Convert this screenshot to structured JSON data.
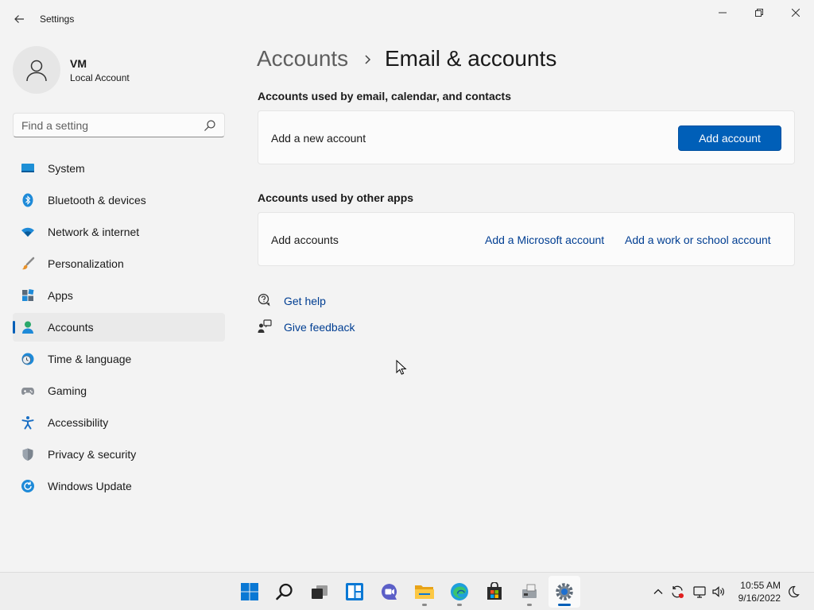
{
  "window": {
    "title": "Settings",
    "back_icon": "arrow-left-icon",
    "controls": [
      "minimize-icon",
      "restore-icon",
      "close-icon"
    ]
  },
  "user": {
    "name": "VM",
    "account_type": "Local Account",
    "avatar_icon": "person-icon"
  },
  "search": {
    "placeholder": "Find a setting",
    "value": "",
    "icon": "search-icon"
  },
  "sidebar": {
    "items": [
      {
        "label": "System",
        "icon": "system-icon"
      },
      {
        "label": "Bluetooth & devices",
        "icon": "bluetooth-icon"
      },
      {
        "label": "Network & internet",
        "icon": "wifi-icon"
      },
      {
        "label": "Personalization",
        "icon": "brush-icon"
      },
      {
        "label": "Apps",
        "icon": "apps-icon"
      },
      {
        "label": "Accounts",
        "icon": "accounts-icon",
        "active": true
      },
      {
        "label": "Time & language",
        "icon": "clock-globe-icon"
      },
      {
        "label": "Gaming",
        "icon": "gamepad-icon"
      },
      {
        "label": "Accessibility",
        "icon": "accessibility-icon"
      },
      {
        "label": "Privacy & security",
        "icon": "shield-icon"
      },
      {
        "label": "Windows Update",
        "icon": "update-icon"
      }
    ]
  },
  "breadcrumb": {
    "parent": "Accounts",
    "current": "Email & accounts"
  },
  "sections": {
    "email": {
      "title": "Accounts used by email, calendar, and contacts",
      "row_label": "Add a new account",
      "button_label": "Add account"
    },
    "other_apps": {
      "title": "Accounts used by other apps",
      "row_label": "Add accounts",
      "link_microsoft": "Add a Microsoft account",
      "link_work": "Add a work or school account"
    }
  },
  "help": {
    "get_help": "Get help",
    "give_feedback": "Give feedback"
  },
  "taskbar": {
    "apps": [
      "start-icon",
      "search-icon",
      "task-view-icon",
      "widgets-icon",
      "chat-icon",
      "file-explorer-icon",
      "edge-icon",
      "store-icon",
      "app-icon",
      "settings-icon"
    ],
    "active_app": "settings-icon",
    "tray": [
      "chevron-up-icon",
      "sync-icon",
      "network-icon",
      "volume-icon"
    ],
    "time": "10:55 AM",
    "date": "9/16/2022"
  },
  "colors": {
    "accent": "#005fb8",
    "link": "#003e92",
    "background": "#f3f3f3",
    "card": "#fbfbfb"
  }
}
